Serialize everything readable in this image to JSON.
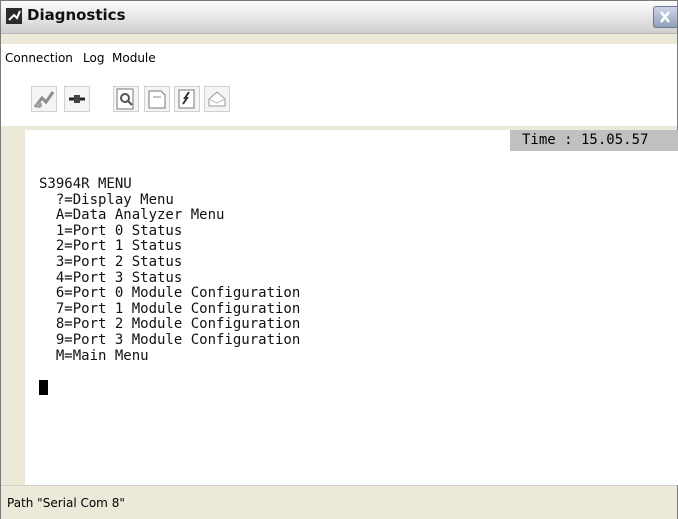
{
  "window": {
    "title": "Diagnostics"
  },
  "menu": {
    "items": [
      "Connection",
      "Log",
      "Module"
    ]
  },
  "toolbar": {
    "buttons": [
      "connect-icon",
      "disconnect-icon",
      "find-icon",
      "open-icon",
      "edit-icon",
      "print-icon"
    ]
  },
  "terminal": {
    "time": "Time : 15.05.57",
    "lines": [
      "S3964R MENU",
      "  ?=Display Menu",
      "  A=Data Analyzer Menu",
      "  1=Port 0 Status",
      "  2=Port 1 Status",
      "  3=Port 2 Status",
      "  4=Port 3 Status",
      "  6=Port 0 Module Configuration",
      "  7=Port 1 Module Configuration",
      "  8=Port 2 Module Configuration",
      "  9=Port 3 Module Configuration",
      "  M=Main Menu"
    ]
  },
  "status": {
    "path": "Path \"Serial Com 8\""
  }
}
